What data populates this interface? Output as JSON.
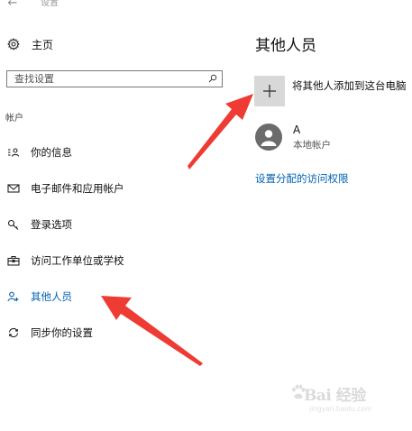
{
  "window": {
    "title": "设置",
    "back_glyph": "←"
  },
  "sidebar": {
    "home_label": "主页",
    "search_placeholder": "查找设置",
    "section_label": "帐户",
    "items": [
      {
        "label": "你的信息",
        "icon": "person-card-icon",
        "active": false
      },
      {
        "label": "电子邮件和应用帐户",
        "icon": "mail-icon",
        "active": false
      },
      {
        "label": "登录选项",
        "icon": "key-icon",
        "active": false
      },
      {
        "label": "访问工作单位或学校",
        "icon": "briefcase-icon",
        "active": false
      },
      {
        "label": "其他人员",
        "icon": "people-add-icon",
        "active": true
      },
      {
        "label": "同步你的设置",
        "icon": "sync-icon",
        "active": false
      }
    ]
  },
  "main": {
    "title": "其他人员",
    "add_tile_glyph": "+",
    "add_label": "将其他人添加到这台电脑",
    "user": {
      "name": "A",
      "type": "本地帐户"
    },
    "access_link": "设置分配的访问权限"
  },
  "watermark": {
    "brand": "Bai 经验",
    "url": "jingyan.baidu.com"
  },
  "colors": {
    "accent": "#0063b1",
    "arrow": "#ee3b33",
    "tile": "#d8d8d8",
    "avatar": "#6b6b6b"
  }
}
